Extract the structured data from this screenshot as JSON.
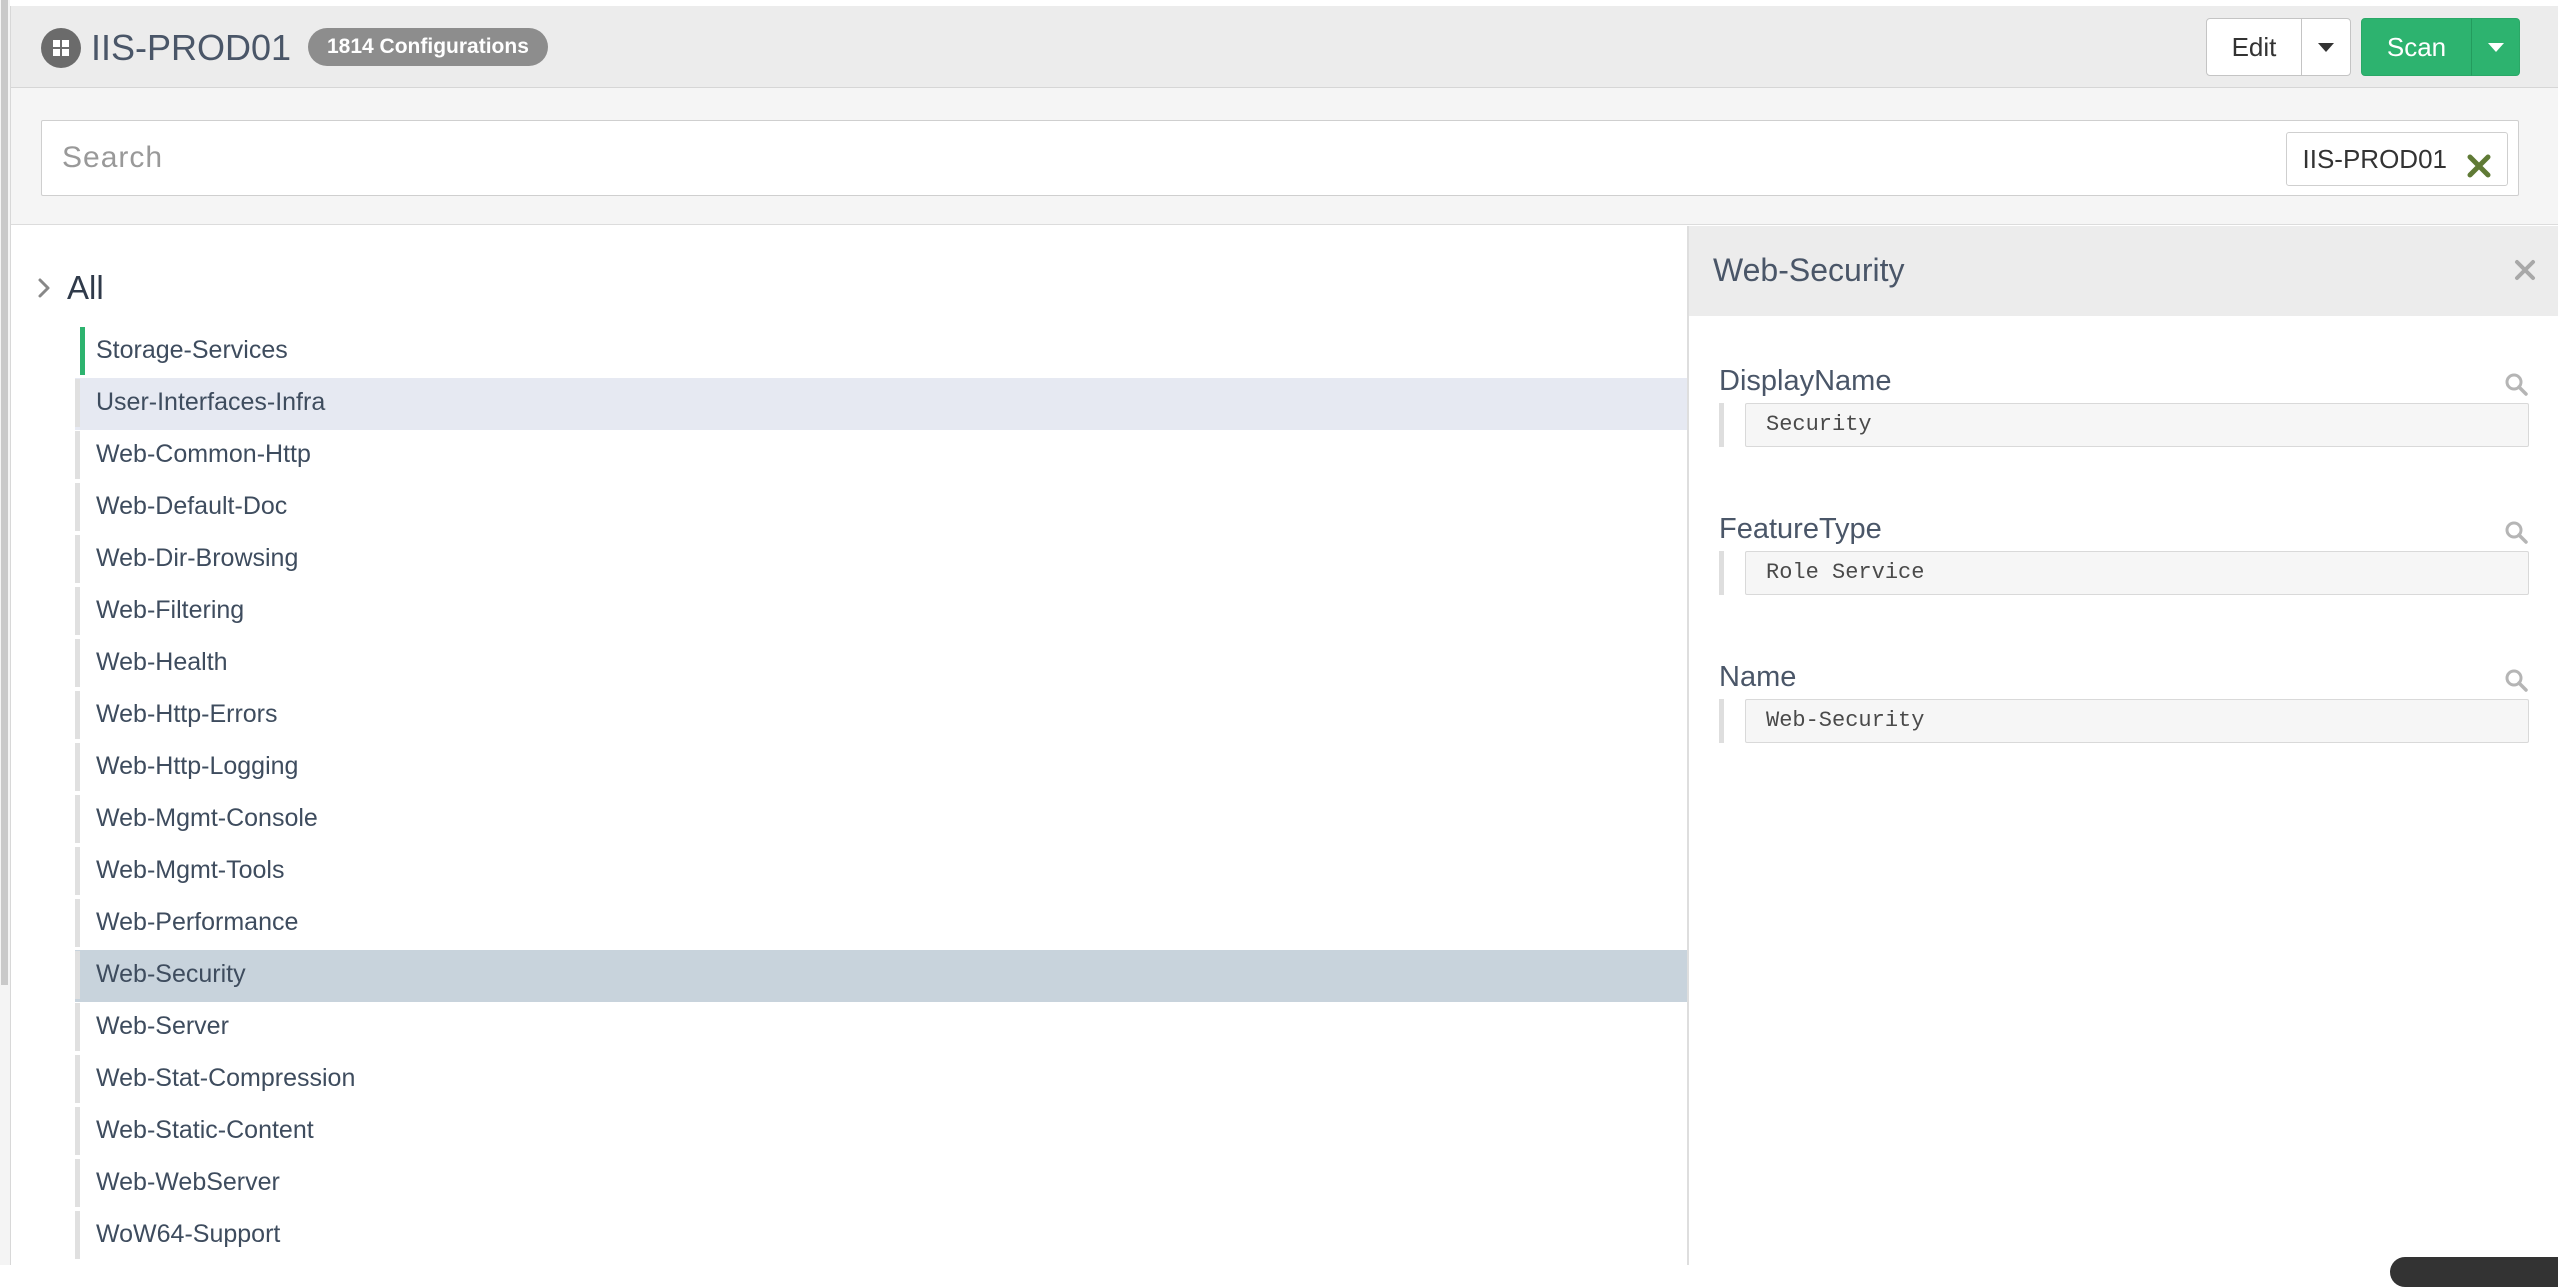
{
  "header": {
    "server_name": "IIS-PROD01",
    "config_badge": "1814 Configurations",
    "edit_label": "Edit",
    "scan_label": "Scan",
    "scan_color": "#2db36f"
  },
  "search": {
    "placeholder": "Search",
    "value": "",
    "filter_chip": "IIS-PROD01"
  },
  "tree": {
    "root_label": "All",
    "items": [
      {
        "label": "Storage-Services",
        "state": "first"
      },
      {
        "label": "User-Interfaces-Infra",
        "state": "hover"
      },
      {
        "label": "Web-Common-Http",
        "state": ""
      },
      {
        "label": "Web-Default-Doc",
        "state": ""
      },
      {
        "label": "Web-Dir-Browsing",
        "state": ""
      },
      {
        "label": "Web-Filtering",
        "state": ""
      },
      {
        "label": "Web-Health",
        "state": ""
      },
      {
        "label": "Web-Http-Errors",
        "state": ""
      },
      {
        "label": "Web-Http-Logging",
        "state": ""
      },
      {
        "label": "Web-Mgmt-Console",
        "state": ""
      },
      {
        "label": "Web-Mgmt-Tools",
        "state": ""
      },
      {
        "label": "Web-Performance",
        "state": ""
      },
      {
        "label": "Web-Security",
        "state": "selected"
      },
      {
        "label": "Web-Server",
        "state": ""
      },
      {
        "label": "Web-Stat-Compression",
        "state": ""
      },
      {
        "label": "Web-Static-Content",
        "state": ""
      },
      {
        "label": "Web-WebServer",
        "state": ""
      },
      {
        "label": "WoW64-Support",
        "state": ""
      }
    ]
  },
  "detail": {
    "title": "Web-Security",
    "fields": [
      {
        "label": "DisplayName",
        "value": "Security"
      },
      {
        "label": "FeatureType",
        "value": "Role Service"
      },
      {
        "label": "Name",
        "value": "Web-Security"
      }
    ]
  },
  "icons": {
    "server": "windows-server-icon",
    "chevron": "chevron-right-icon",
    "chip_remove": "close-x-icon",
    "panel_close": "close-icon",
    "field_search": "search-icon"
  }
}
